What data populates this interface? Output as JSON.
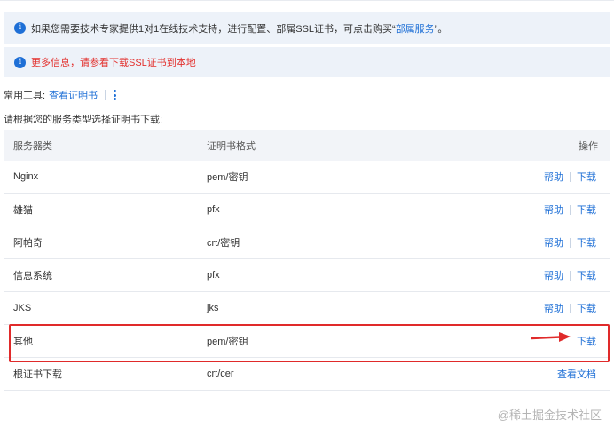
{
  "notice_primary": {
    "prefix": "如果您需要技术专家提供1对1在线技术支持，进行配置、部属SSL证书，可点击购买“",
    "link": "部属服务",
    "suffix": "”。"
  },
  "notice_secondary": {
    "text": "更多信息，请参看下载SSL证书到本地"
  },
  "tools": {
    "label": "常用工具:",
    "view_cert": "查看证明书"
  },
  "hint": "请根据您的服务类型选择证明书下载:",
  "table": {
    "headers": [
      "服务器类",
      "证明书格式",
      "操作"
    ],
    "rows": [
      {
        "server": "Nginx",
        "format": "pem/密钥",
        "help": "帮助",
        "action": "下载"
      },
      {
        "server": "雄猫",
        "format": "pfx",
        "help": "帮助",
        "action": "下载"
      },
      {
        "server": "阿帕奇",
        "format": "crt/密钥",
        "help": "帮助",
        "action": "下载"
      },
      {
        "server": "信息系统",
        "format": "pfx",
        "help": "帮助",
        "action": "下载"
      },
      {
        "server": "JKS",
        "format": "jks",
        "help": "帮助",
        "action": "下载"
      },
      {
        "server": "其他",
        "format": "pem/密钥",
        "help": "",
        "action": "下载"
      },
      {
        "server": "根证书下载",
        "format": "crt/cer",
        "help": "",
        "action": "查看文档"
      }
    ]
  },
  "watermark": "@稀土掘金技术社区",
  "colors": {
    "link": "#1e6fd6",
    "notice_bg": "#edf2f9",
    "warning_text": "#e3302d",
    "highlight": "#e02a2a"
  }
}
